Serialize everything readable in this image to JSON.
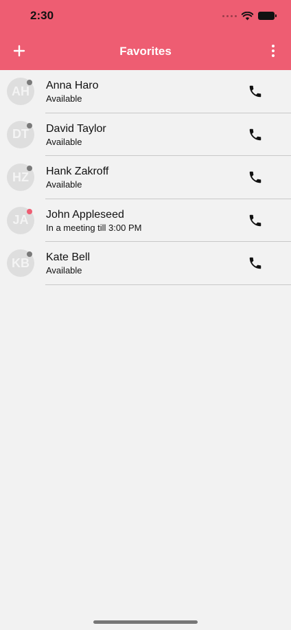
{
  "status_bar": {
    "time": "2:30"
  },
  "nav": {
    "add_icon": "plus-icon",
    "title": "Favorites",
    "more_icon": "more-vertical-icon"
  },
  "colors": {
    "header": "#ee5d72",
    "busy": "#ee5d72",
    "available": "#7a7a7a"
  },
  "contacts": [
    {
      "initials": "AH",
      "name": "Anna Haro",
      "status": "Available",
      "presence": "available"
    },
    {
      "initials": "DT",
      "name": "David Taylor",
      "status": "Available",
      "presence": "available"
    },
    {
      "initials": "HZ",
      "name": "Hank Zakroff",
      "status": "Available",
      "presence": "available"
    },
    {
      "initials": "JA",
      "name": "John Appleseed",
      "status": "In a meeting till 3:00 PM",
      "presence": "busy"
    },
    {
      "initials": "KB",
      "name": "Kate Bell",
      "status": "Available",
      "presence": "available"
    }
  ]
}
